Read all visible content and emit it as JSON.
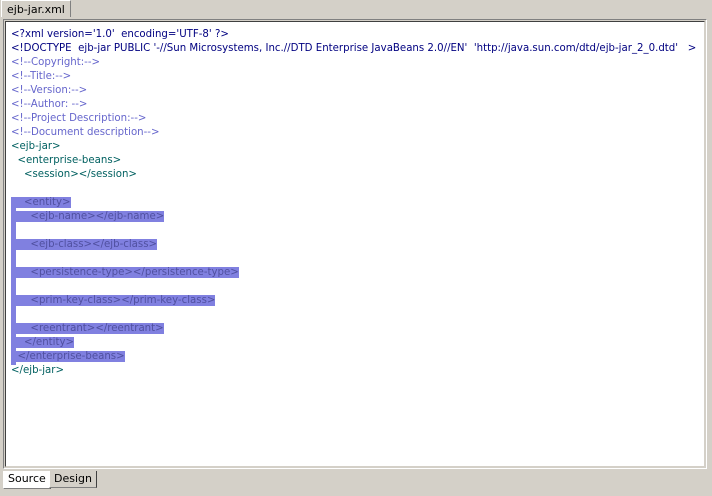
{
  "tab": {
    "filename": "ejb-jar.xml"
  },
  "editor": {
    "lines": [
      "<?xml version='1.0'  encoding='UTF-8' ?>",
      "<!DOCTYPE  ejb-jar PUBLIC '-//Sun Microsystems, Inc.//DTD Enterprise JavaBeans 2.0//EN'  'http://java.sun.com/dtd/ejb-jar_2_0.dtd'   >",
      "<!--Copyright:-->",
      "<!--Title:-->",
      "<!--Version:-->",
      "<!--Author: -->",
      "<!--Project Description:-->",
      "<!--Document description-->",
      "<ejb-jar>",
      "  <enterprise-beans>",
      "    <session></session>",
      "",
      "    <entity>",
      "      <ejb-name></ejb-name>",
      "",
      "      <ejb-class></ejb-class>",
      "",
      "      <persistence-type></persistence-type>",
      "",
      "      <prim-key-class></prim-key-class>",
      "",
      "      <reentrant></reentrant>",
      "    </entity>",
      "  </enterprise-beans>",
      "</ejb-jar>"
    ]
  },
  "bottom_tabs": [
    {
      "label": "Source",
      "active": true
    },
    {
      "label": "Design",
      "active": false
    }
  ]
}
